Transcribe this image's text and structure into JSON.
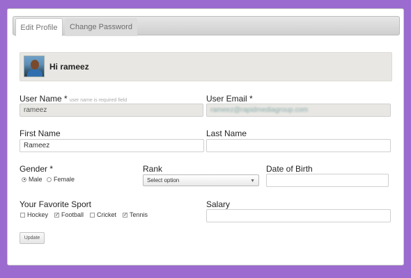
{
  "tabs": [
    {
      "label": "Edit Profile",
      "active": true
    },
    {
      "label": "Change Password",
      "active": false
    }
  ],
  "greeting": "Hi rameez",
  "fields": {
    "user_name": {
      "label": "User Name *",
      "hint": "user name is required field",
      "value": "rameez"
    },
    "user_email": {
      "label": "User Email *",
      "value": "rameez@rapidmediagroup.com"
    },
    "first_name": {
      "label": "First Name",
      "value": "Rameez"
    },
    "last_name": {
      "label": "Last Name",
      "value": ""
    },
    "gender": {
      "label": "Gender *",
      "options": [
        "Male",
        "Female"
      ],
      "selected": "Male"
    },
    "rank": {
      "label": "Rank",
      "selected": "Select option"
    },
    "dob": {
      "label": "Date of Birth",
      "value": ""
    },
    "sport": {
      "label": "Your Favorite Sport",
      "options": [
        {
          "label": "Hockey",
          "checked": false
        },
        {
          "label": "Football",
          "checked": true
        },
        {
          "label": "Cricket",
          "checked": false
        },
        {
          "label": "Tennis",
          "checked": true
        }
      ]
    },
    "salary": {
      "label": "Salary",
      "value": ""
    }
  },
  "update_button": "Update",
  "colors": {
    "background": "#9b6bd0",
    "panel": "#e8e7e3"
  }
}
